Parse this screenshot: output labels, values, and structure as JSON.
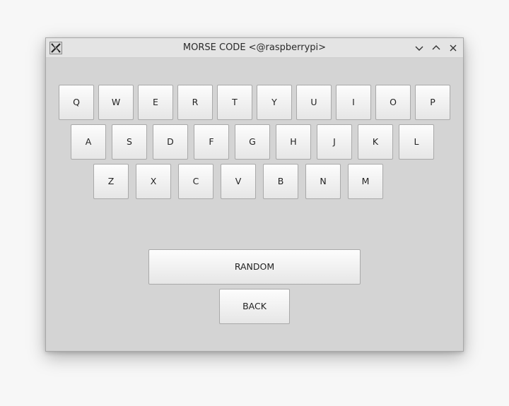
{
  "window": {
    "title": "MORSE CODE <@raspberrypi>",
    "app_icon": "x-window-icon",
    "controls": {
      "minimize_icon": "chevron-down-icon",
      "maximize_icon": "chevron-up-icon",
      "close_icon": "close-icon"
    }
  },
  "keyboard": {
    "row1": [
      "Q",
      "W",
      "E",
      "R",
      "T",
      "Y",
      "U",
      "I",
      "O",
      "P"
    ],
    "row2": [
      "A",
      "S",
      "D",
      "F",
      "G",
      "H",
      "J",
      "K",
      "L"
    ],
    "row3": [
      "Z",
      "X",
      "C",
      "V",
      "B",
      "N",
      "M"
    ]
  },
  "actions": {
    "random_label": "RANDOM",
    "back_label": "BACK"
  }
}
